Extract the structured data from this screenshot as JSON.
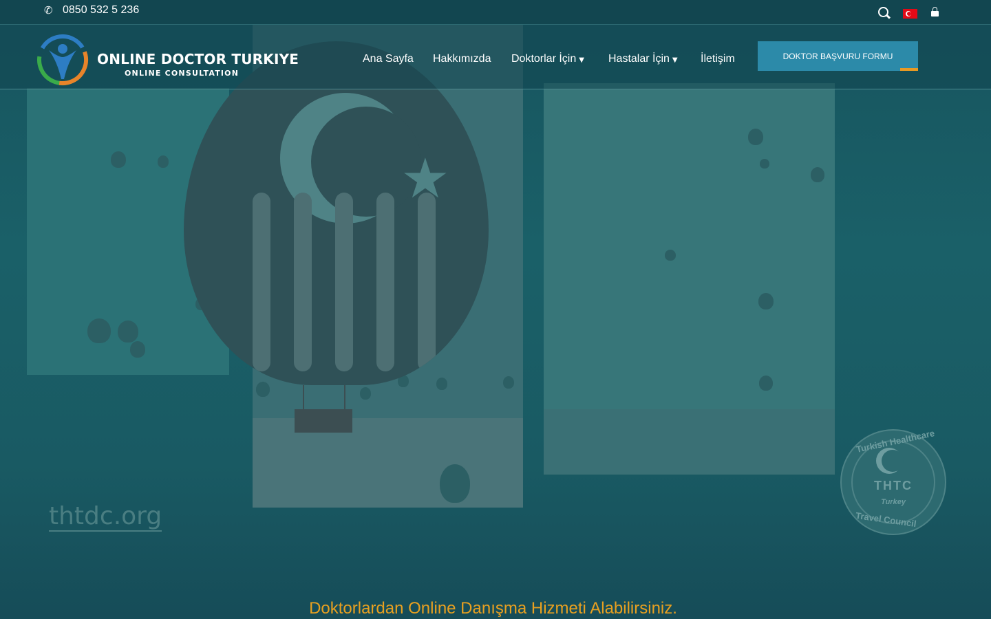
{
  "topbar": {
    "phone": "0850 532 5 236",
    "icons": [
      "phone-icon",
      "search-icon",
      "turkish-flag-icon",
      "lock-icon"
    ]
  },
  "header": {
    "logo_title": "ONLINE DOCTOR TURKIYE",
    "logo_subtitle": "ONLINE CONSULTATION",
    "nav": [
      {
        "label": "Ana Sayfa"
      },
      {
        "label": "Hakkımızda"
      },
      {
        "label": "Doktorlar İçin",
        "dropdown": true
      },
      {
        "label": "Hastalar İçin",
        "dropdown": true
      },
      {
        "label": "İletişim"
      }
    ],
    "cta_label": "DOKTOR BAŞVURU FORMU"
  },
  "hero": {
    "watermark": "thtdc.org",
    "badge": {
      "top": "Turkish Healthcare",
      "center": "THTC",
      "script": "Turkey",
      "bottom": "Travel Council"
    },
    "tagline": "Doktorlardan Online Danışma Hizmeti Alabilirsiniz."
  },
  "colors": {
    "background": "#1a5f66",
    "topbar": "#124650",
    "cta": "#2c8aa9",
    "accent": "#e89a24",
    "tagline": "#e8a020"
  }
}
